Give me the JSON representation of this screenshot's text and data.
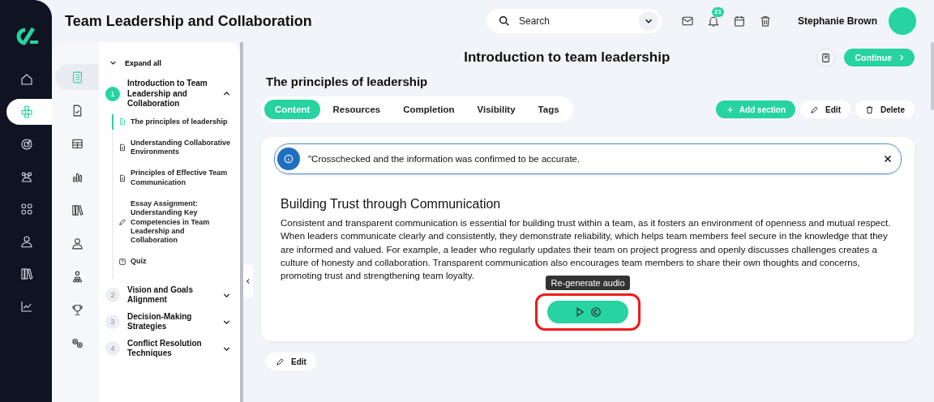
{
  "app_title": "Team Leadership and Collaboration",
  "search": {
    "placeholder": "Search"
  },
  "notifications": {
    "count": "21"
  },
  "user": {
    "name": "Stephanie Brown"
  },
  "rail": {
    "items": [
      {
        "kind": "home",
        "selected": false
      },
      {
        "kind": "cubes",
        "selected": true
      },
      {
        "kind": "target",
        "selected": false
      },
      {
        "kind": "people",
        "selected": false
      },
      {
        "kind": "grid",
        "selected": false
      },
      {
        "kind": "person",
        "selected": false
      },
      {
        "kind": "books",
        "selected": false
      },
      {
        "kind": "chart",
        "selected": false
      }
    ]
  },
  "tools": {
    "items": [
      {
        "kind": "book",
        "selected": true
      },
      {
        "kind": "file-check",
        "selected": false
      },
      {
        "kind": "table",
        "selected": false
      },
      {
        "kind": "bars",
        "selected": false
      },
      {
        "kind": "books",
        "selected": false
      },
      {
        "kind": "person",
        "selected": false
      },
      {
        "kind": "org",
        "selected": false
      },
      {
        "kind": "trophy",
        "selected": false
      },
      {
        "kind": "gears",
        "selected": false
      }
    ]
  },
  "outline": {
    "expand_all": "Expand all",
    "modules": [
      {
        "number": "1",
        "title": "Introduction to Team Leadership and Collaboration",
        "expanded": true,
        "lessons": [
          {
            "kind": "page",
            "title": "The principles of leadership",
            "selected": true
          },
          {
            "kind": "page",
            "title": "Understanding Collaborative Environments",
            "selected": false
          },
          {
            "kind": "page",
            "title": "Principles of Effective Team Communication",
            "selected": false
          },
          {
            "kind": "essay",
            "title": "Essay Assignment: Understanding Key Competencies in Team Leadership and Collaboration",
            "selected": false
          },
          {
            "kind": "quiz",
            "title": "Quiz",
            "selected": false
          }
        ]
      },
      {
        "number": "2",
        "title": "Vision and Goals Alignment",
        "expanded": false
      },
      {
        "number": "3",
        "title": "Decision-Making Strategies",
        "expanded": false
      },
      {
        "number": "4",
        "title": "Conflict Resolution Techniques",
        "expanded": false
      }
    ]
  },
  "page": {
    "title": "Introduction to team leadership",
    "continue": "Continue",
    "section_title": "The principles of leadership",
    "tabs": [
      {
        "label": "Content",
        "selected": true
      },
      {
        "label": "Resources",
        "selected": false
      },
      {
        "label": "Completion",
        "selected": false
      },
      {
        "label": "Visibility",
        "selected": false
      },
      {
        "label": "Tags",
        "selected": false
      }
    ],
    "add_section": "Add section",
    "edit": "Edit",
    "delete": "Delete"
  },
  "alert": {
    "text": "\"Crosschecked and the information was confirmed to be accurate."
  },
  "content": {
    "heading": "Building Trust through Communication",
    "paragraph": "Consistent and transparent communication is essential for building trust within a team, as it fosters an environment of openness and mutual respect. When leaders communicate clearly and consistently, they demonstrate reliability, which helps team members feel secure in the knowledge that they are informed and valued. For example, a leader who regularly updates their team on project progress and openly discusses challenges creates a culture of honesty and collaboration. Transparent communication also encourages team members to share their own thoughts and concerns, promoting trust and strengthening team loyalty.",
    "audio_tooltip": "Re-generate audio",
    "highlighted": true
  },
  "footer": {
    "edit": "Edit"
  }
}
